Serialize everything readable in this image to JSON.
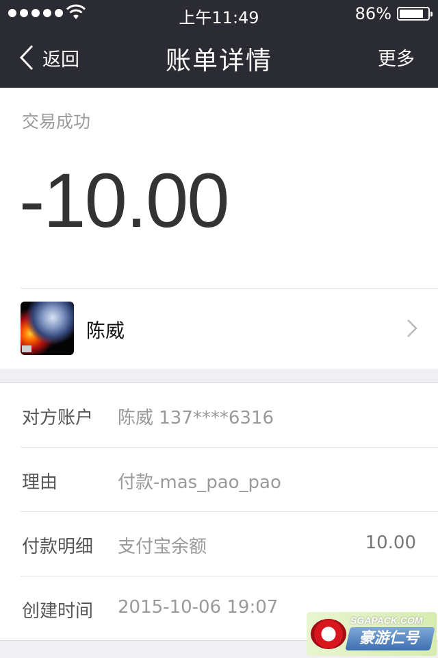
{
  "status_bar": {
    "time": "上午11:49",
    "battery_percent": "86%",
    "battery_level": 0.86,
    "signal_dots": 5
  },
  "nav": {
    "back_label": "返回",
    "title": "账单详情",
    "more_label": "更多"
  },
  "transaction": {
    "status": "交易成功",
    "amount": "-10.00",
    "payee_name": "陈威"
  },
  "details": {
    "rows": [
      {
        "label": "对方账户",
        "value": "陈威 137****6316",
        "amount": ""
      },
      {
        "label": "理由",
        "value": "付款-mas_pao_pao",
        "amount": ""
      },
      {
        "label": "付款明细",
        "value": "支付宝余额",
        "amount": "10.00"
      },
      {
        "label": "创建时间",
        "value": "2015-10-06 19:07",
        "amount": ""
      }
    ]
  },
  "watermark": {
    "top_text": "SGAPACK.COM",
    "main_text": "豪游仁号"
  },
  "colors": {
    "header_bg": "#2a2b33",
    "page_bg": "#efeff4",
    "amount_text": "#333333",
    "muted_text": "#9a9a9a"
  }
}
